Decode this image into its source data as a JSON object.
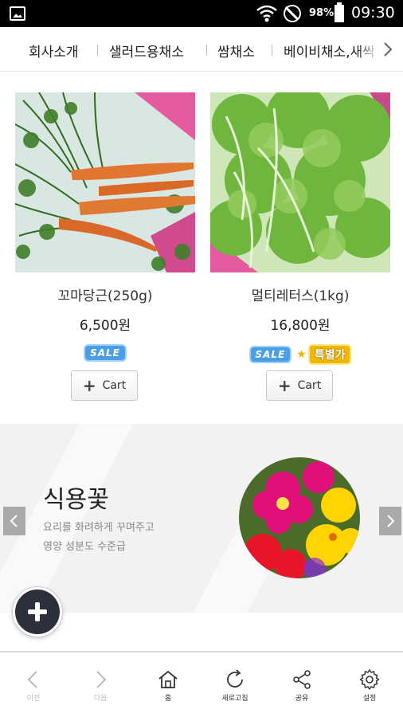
{
  "status_bar": {
    "battery": "98%",
    "time": "09:30"
  },
  "category_nav": {
    "items": [
      "회사소개",
      "샐러드용채소",
      "쌈채소",
      "베이비채소,새싹"
    ]
  },
  "products": [
    {
      "name": "꼬마당근(250g)",
      "price": "6,500원",
      "badges": [
        "SALE"
      ],
      "cart_label": "Cart"
    },
    {
      "name": "멀티레터스(1kg)",
      "price": "16,800원",
      "badges": [
        "SALE",
        "특별가"
      ],
      "cart_label": "Cart"
    }
  ],
  "banner": {
    "title": "식용꽃",
    "line1": "요리를 화려하게 꾸며주고",
    "line2": "영양 성분도 수준급"
  },
  "toolbar": {
    "items": [
      {
        "label": "이전",
        "icon": "chevron-left-icon",
        "enabled": false
      },
      {
        "label": "다음",
        "icon": "chevron-right-icon",
        "enabled": false
      },
      {
        "label": "홈",
        "icon": "home-icon",
        "enabled": true
      },
      {
        "label": "새로고침",
        "icon": "refresh-icon",
        "enabled": true
      },
      {
        "label": "공유",
        "icon": "share-icon",
        "enabled": true
      },
      {
        "label": "설정",
        "icon": "gear-icon",
        "enabled": true
      }
    ]
  },
  "colors": {
    "fab": "#2b303b",
    "sale_badge": "#4a9fe6",
    "special_badge": "#f0b600",
    "banner_bg": "#f2f2f2"
  }
}
